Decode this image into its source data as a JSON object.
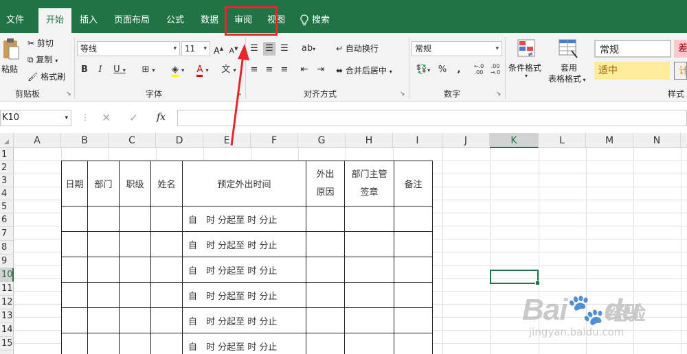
{
  "menu": {
    "tabs": [
      {
        "label": "文件",
        "active": false
      },
      {
        "label": "开始",
        "active": true
      },
      {
        "label": "插入",
        "active": false
      },
      {
        "label": "页面布局",
        "active": false
      },
      {
        "label": "公式",
        "active": false
      },
      {
        "label": "数据",
        "active": false
      },
      {
        "label": "审阅",
        "active": false,
        "highlighted": true
      },
      {
        "label": "视图",
        "active": false
      },
      {
        "label": "搜索",
        "active": false
      }
    ]
  },
  "ribbon": {
    "clipboard": {
      "paste": "粘贴",
      "cut": "剪切",
      "copy": "复制",
      "format_painter": "格式刷",
      "group": "剪贴板"
    },
    "font": {
      "name": "等线",
      "size": "11",
      "group": "字体"
    },
    "alignment": {
      "wrap": "自动换行",
      "merge": "合并后居中",
      "group": "对齐方式"
    },
    "number": {
      "format": "常规",
      "percent": "%",
      "comma": ",",
      "group": "数字"
    },
    "styles": {
      "conditional": "条件格式",
      "table_format_line1": "套用",
      "table_format_line2": "表格格式",
      "normal": "常规",
      "bad": "差",
      "neutral": "适中",
      "calc": "计",
      "group": "样式"
    }
  },
  "formula_bar": {
    "name_box": "K10",
    "fx": "fx",
    "value": ""
  },
  "grid": {
    "columns": [
      "A",
      "B",
      "C",
      "D",
      "E",
      "F",
      "G",
      "H",
      "I",
      "J",
      "K",
      "L",
      "M",
      "N"
    ],
    "selected_column": "K",
    "rows": [
      "1",
      "2",
      "3",
      "4",
      "5",
      "6",
      "7",
      "8",
      "9",
      "10",
      "11",
      "12",
      "13",
      "14",
      "15"
    ],
    "selected_row": "10"
  },
  "form": {
    "headers": {
      "date": "日期",
      "dept": "部门",
      "level": "职级",
      "name": "姓名",
      "planned_time": "预定外出时间",
      "reason_line1": "外出",
      "reason_line2": "原因",
      "approval_line1": "部门主管",
      "approval_line2": "签章",
      "remark": "备注"
    },
    "time_slot": "自　时 分起至 时 分止",
    "rows": 6
  },
  "watermark": {
    "brand": "Bai",
    "brand2": "du",
    "cn": "经验",
    "url": "jingyan.baidu.com"
  },
  "colors": {
    "excel_green": "#217346",
    "highlight_red": "#e8262b",
    "style_bad_bg": "#ffc7ce",
    "style_neutral_bg": "#ffeb9c"
  }
}
